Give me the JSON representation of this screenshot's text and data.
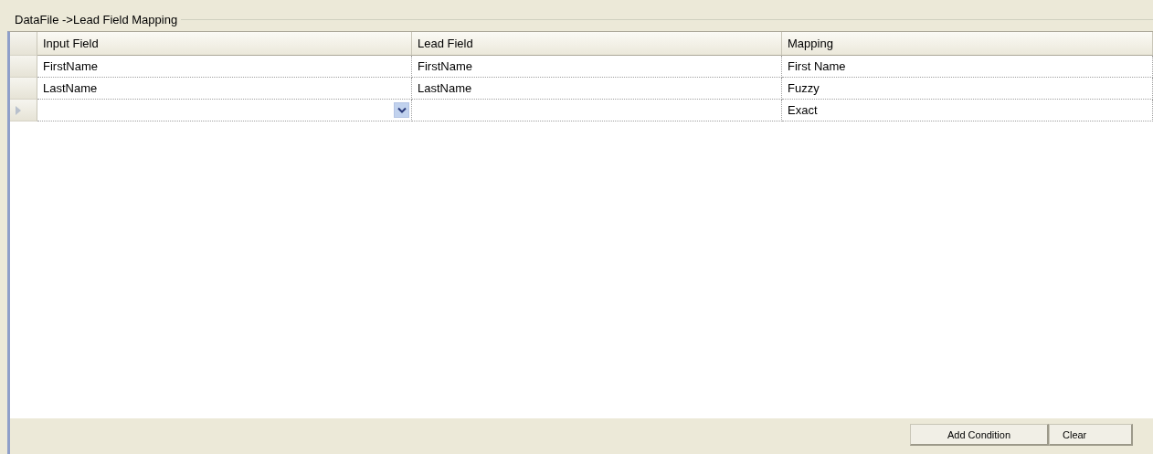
{
  "group_box": {
    "title": "DataFile ->Lead Field Mapping"
  },
  "table": {
    "columns": [
      "Input Field",
      "Lead Field",
      "Mapping"
    ],
    "rows": [
      {
        "cells": [
          {
            "kind": "text",
            "text": "FirstName"
          },
          {
            "kind": "text",
            "text": "FirstName"
          },
          {
            "kind": "text",
            "text": "First Name"
          }
        ],
        "current": false
      },
      {
        "cells": [
          {
            "kind": "text",
            "text": "LastName"
          },
          {
            "kind": "text",
            "text": "LastName"
          },
          {
            "kind": "text",
            "text": "Fuzzy"
          }
        ],
        "current": false
      },
      {
        "cells": [
          {
            "kind": "dropdown"
          },
          {
            "kind": "text"
          },
          {
            "kind": "text",
            "text": "Exact"
          }
        ],
        "current": true
      }
    ]
  },
  "buttons": [
    "Add Condition",
    "Clear"
  ]
}
